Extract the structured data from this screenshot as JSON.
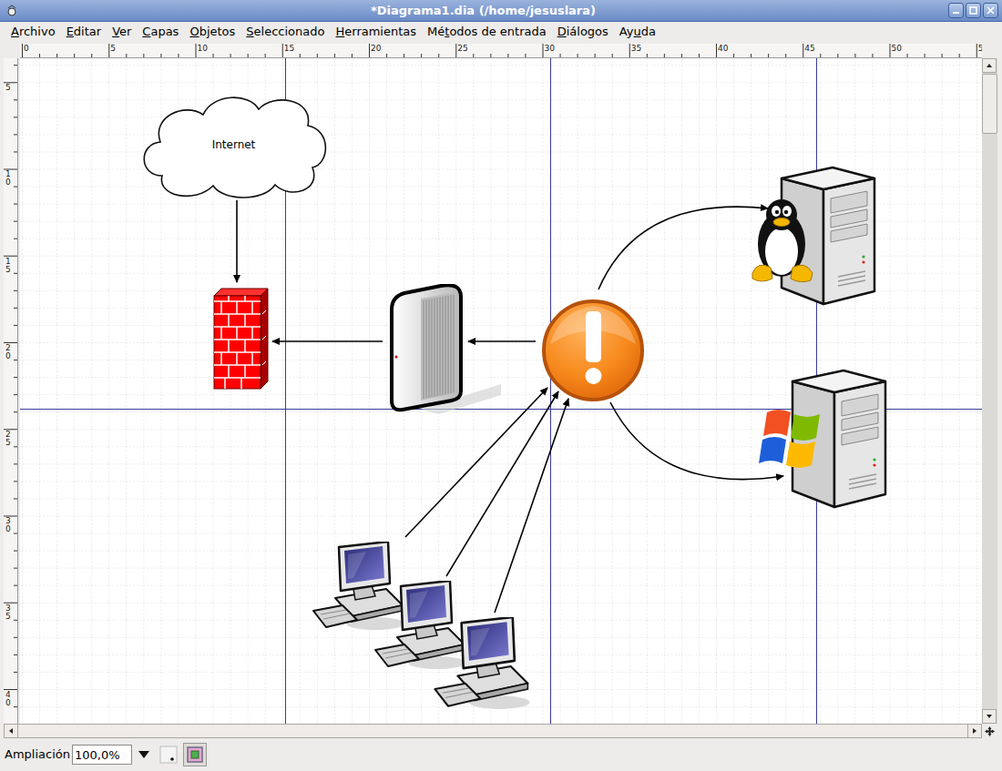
{
  "window": {
    "title": "*Diagrama1.dia (/home/jesuslara)"
  },
  "menu": [
    {
      "label": "Archivo",
      "mnemonic": 0
    },
    {
      "label": "Editar",
      "mnemonic": 0
    },
    {
      "label": "Ver",
      "mnemonic": 0
    },
    {
      "label": "Capas",
      "mnemonic": 0
    },
    {
      "label": "Objetos",
      "mnemonic": 0
    },
    {
      "label": "Seleccionado",
      "mnemonic": 0
    },
    {
      "label": "Herramientas",
      "mnemonic": 0
    },
    {
      "label": "Métodos de entrada",
      "mnemonic": 2
    },
    {
      "label": "Diálogos",
      "mnemonic": 0
    },
    {
      "label": "Ayuda",
      "mnemonic": 2
    }
  ],
  "ruler_horizontal": [
    "0",
    "5",
    "10",
    "15",
    "20",
    "25",
    "30",
    "35",
    "40",
    "45",
    "50",
    "5"
  ],
  "ruler_vertical": [
    "5",
    "10",
    "15",
    "20",
    "25",
    "30",
    "35",
    "40"
  ],
  "diagram": {
    "nodes": [
      {
        "kind": "cloud",
        "label": "Internet"
      },
      {
        "kind": "firewall"
      },
      {
        "kind": "server"
      },
      {
        "kind": "alert"
      },
      {
        "kind": "linux-server"
      },
      {
        "kind": "windows-server"
      },
      {
        "kind": "workstation"
      },
      {
        "kind": "workstation"
      },
      {
        "kind": "workstation"
      }
    ]
  },
  "status_bar": {
    "zoom_label": "Ampliación",
    "zoom_value": "100,0%"
  }
}
